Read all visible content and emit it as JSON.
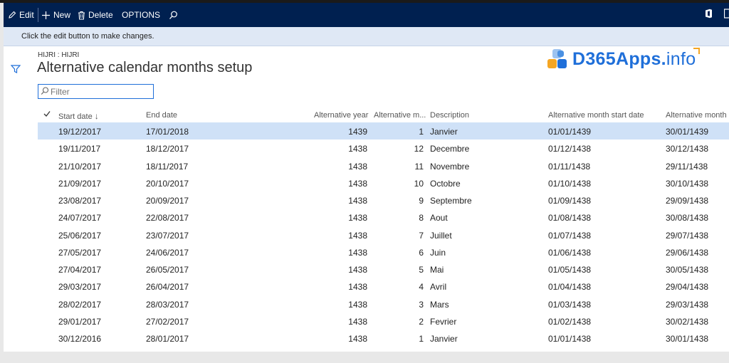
{
  "actionbar": {
    "edit": "Edit",
    "new": "New",
    "delete": "Delete",
    "options": "OPTIONS"
  },
  "message": "Click the edit button to make changes.",
  "page": {
    "caption": "HIJRI : HIJRI",
    "title": "Alternative calendar months setup"
  },
  "logo": {
    "main": "D365Apps.",
    "suffix": "info",
    "colors": [
      "#f5a623",
      "#1f6fd9",
      "#4a90e2",
      "#9dc3f0"
    ]
  },
  "filter": {
    "placeholder": "Filter"
  },
  "grid": {
    "columns": {
      "start_date": "Start date",
      "end_date": "End date",
      "alt_year": "Alternative year",
      "alt_month": "Alternative m...",
      "description": "Description",
      "alt_start": "Alternative month start date",
      "alt_end": "Alternative month e"
    },
    "rows": [
      {
        "start": "19/12/2017",
        "end": "17/01/2018",
        "year": "1439",
        "month": "1",
        "desc": "Janvier",
        "astart": "01/01/1439",
        "aend": "30/01/1439"
      },
      {
        "start": "19/11/2017",
        "end": "18/12/2017",
        "year": "1438",
        "month": "12",
        "desc": "Decembre",
        "astart": "01/12/1438",
        "aend": "30/12/1438"
      },
      {
        "start": "21/10/2017",
        "end": "18/11/2017",
        "year": "1438",
        "month": "11",
        "desc": "Novembre",
        "astart": "01/11/1438",
        "aend": "29/11/1438"
      },
      {
        "start": "21/09/2017",
        "end": "20/10/2017",
        "year": "1438",
        "month": "10",
        "desc": "Octobre",
        "astart": "01/10/1438",
        "aend": "30/10/1438"
      },
      {
        "start": "23/08/2017",
        "end": "20/09/2017",
        "year": "1438",
        "month": "9",
        "desc": "Septembre",
        "astart": "01/09/1438",
        "aend": "29/09/1438"
      },
      {
        "start": "24/07/2017",
        "end": "22/08/2017",
        "year": "1438",
        "month": "8",
        "desc": "Aout",
        "astart": "01/08/1438",
        "aend": "30/08/1438"
      },
      {
        "start": "25/06/2017",
        "end": "23/07/2017",
        "year": "1438",
        "month": "7",
        "desc": "Juillet",
        "astart": "01/07/1438",
        "aend": "29/07/1438"
      },
      {
        "start": "27/05/2017",
        "end": "24/06/2017",
        "year": "1438",
        "month": "6",
        "desc": "Juin",
        "astart": "01/06/1438",
        "aend": "29/06/1438"
      },
      {
        "start": "27/04/2017",
        "end": "26/05/2017",
        "year": "1438",
        "month": "5",
        "desc": "Mai",
        "astart": "01/05/1438",
        "aend": "30/05/1438"
      },
      {
        "start": "29/03/2017",
        "end": "26/04/2017",
        "year": "1438",
        "month": "4",
        "desc": "Avril",
        "astart": "01/04/1438",
        "aend": "29/04/1438"
      },
      {
        "start": "28/02/2017",
        "end": "28/03/2017",
        "year": "1438",
        "month": "3",
        "desc": "Mars",
        "astart": "01/03/1438",
        "aend": "29/03/1438"
      },
      {
        "start": "29/01/2017",
        "end": "27/02/2017",
        "year": "1438",
        "month": "2",
        "desc": "Fevrier",
        "astart": "01/02/1438",
        "aend": "30/02/1438"
      },
      {
        "start": "30/12/2016",
        "end": "28/01/2017",
        "year": "1438",
        "month": "1",
        "desc": "Janvier",
        "astart": "01/01/1438",
        "aend": "30/01/1438"
      }
    ]
  }
}
